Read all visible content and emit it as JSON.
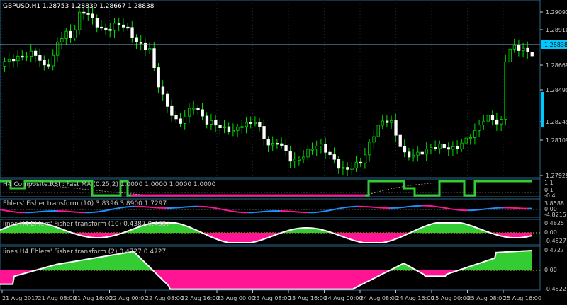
{
  "main": {
    "title": "GBPUSD,H1  1.28753 1.28839 1.28667 1.28838",
    "price_ticks": [
      "1.29091",
      "1.28910",
      "1.28838",
      "1.28669",
      "1.28490",
      "1.28249",
      "1.28109",
      "1.27929"
    ],
    "current_price": "1.28838",
    "colors": {
      "bull": "#00e000",
      "bear": "#ffffff",
      "grid": "#1e3c64",
      "price_line": "#7fb0c8",
      "price_tag": "#00c8ff"
    }
  },
  "panel1": {
    "title": "H4 Composite RSI : Fast MA (0.25,2) 1.0000 1.0000 1.0000 1.0000",
    "ticks": [
      "1.1",
      "0.1",
      "-0.4"
    ]
  },
  "panel2": {
    "title": "Ehlers' Fisher transform (10) 3.8396 3.8900 1.7297",
    "ticks": [
      "3.8588",
      "0.00",
      "-4.8215"
    ]
  },
  "panel3": {
    "title": "lines H4 Ehlers' Fisher transform (10) 0.4387 0.4387",
    "ticks": [
      "0.4825",
      "0.00",
      "-0.4827"
    ]
  },
  "panel4": {
    "title": "lines H4 Ehlers' Fisher transform (2) 0.4727 0.4727",
    "ticks": [
      "0.4727",
      "0.00",
      "-0.4822"
    ]
  },
  "time_axis": [
    "21 Aug 2017",
    "21 Aug 08:00",
    "21 Aug 16:00",
    "22 Aug 00:00",
    "22 Aug 08:00",
    "22 Aug 16:00",
    "23 Aug 00:00",
    "23 Aug 08:00",
    "23 Aug 16:00",
    "24 Aug 00:00",
    "24 Aug 08:00",
    "24 Aug 16:00",
    "25 Aug 00:00",
    "25 Aug 08:00",
    "25 Aug 16:00"
  ],
  "colors": {
    "green": "#33cc33",
    "magenta": "#ff1493",
    "blue": "#1e90ff",
    "white": "#ffffff",
    "divider": "#2a6a8a"
  }
}
